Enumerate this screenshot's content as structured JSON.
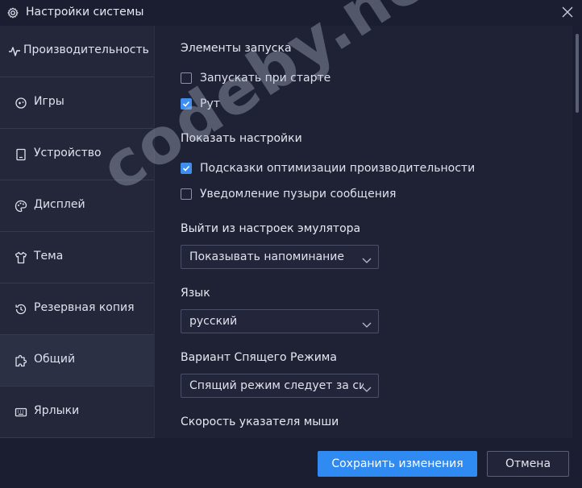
{
  "window": {
    "title": "Настройки системы"
  },
  "sidebar": {
    "items": [
      {
        "label": "Производительность",
        "icon": "pulse-icon"
      },
      {
        "label": "Игры",
        "icon": "gamepad-icon"
      },
      {
        "label": "Устройство",
        "icon": "device-icon"
      },
      {
        "label": "Дисплей",
        "icon": "palette-icon"
      },
      {
        "label": "Тема",
        "icon": "shirt-icon"
      },
      {
        "label": "Резервная копия",
        "icon": "history-icon"
      },
      {
        "label": "Общий",
        "icon": "puzzle-icon",
        "active": true
      },
      {
        "label": "Ярлыки",
        "icon": "keyboard-icon"
      }
    ]
  },
  "content": {
    "startup": {
      "title": "Элементы запуска",
      "launch_on_start": {
        "label": "Запускать при старте",
        "checked": false
      },
      "root": {
        "label": "Рут",
        "checked": true
      }
    },
    "show_settings": {
      "title": "Показать настройки",
      "perf_tips": {
        "label": "Подсказки оптимизации производительности",
        "checked": true
      },
      "bubble_notify": {
        "label": "Уведомление пузыри сообщения",
        "checked": false
      }
    },
    "exit": {
      "title": "Выйти из настроек эмулятора",
      "value": "Показывать напоминание"
    },
    "language": {
      "title": "Язык",
      "value": "русский"
    },
    "sleep": {
      "title": "Вариант Спящего Режима",
      "value": "Спящий режим следует за системой"
    },
    "mouse_speed": {
      "title": "Скорость указателя мыши"
    }
  },
  "footer": {
    "save_label": "Сохранить изменения",
    "cancel_label": "Отмена"
  },
  "watermark": "codeby.net",
  "colors": {
    "accent": "#2f8af2",
    "background": "#1b1e30",
    "sidebar": "#24273a",
    "content": "#1f2235"
  }
}
